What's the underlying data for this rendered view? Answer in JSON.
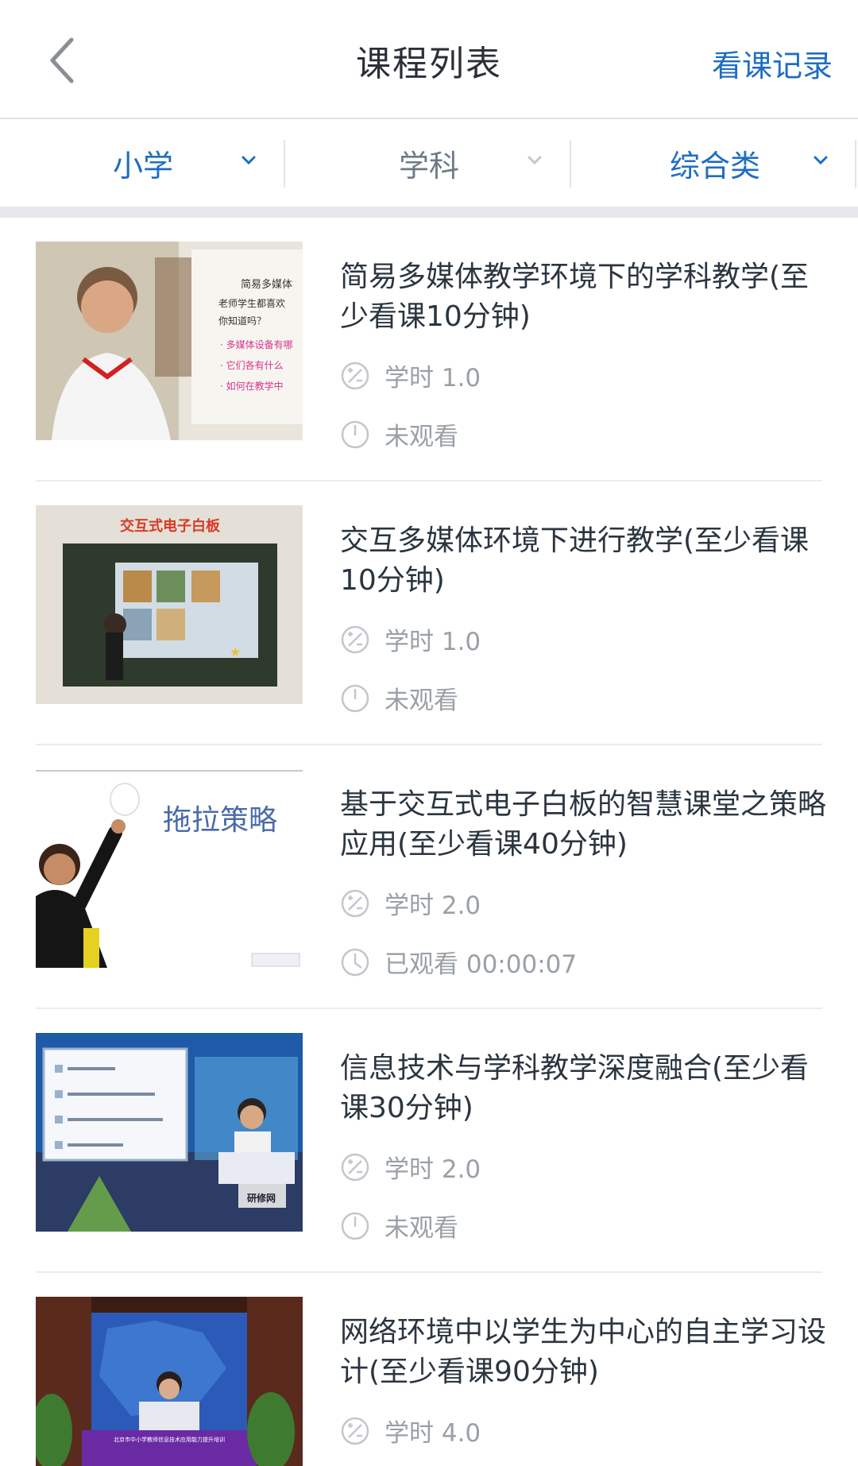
{
  "header": {
    "title": "课程列表",
    "history_label": "看课记录"
  },
  "filters": [
    {
      "label": "小学",
      "active": true
    },
    {
      "label": "学科",
      "active": false
    },
    {
      "label": "综合类",
      "active": true
    }
  ],
  "colors": {
    "accent": "#1f6ec0",
    "meta_gray": "#9aa0a6",
    "title_text": "#2b3540"
  },
  "courses": [
    {
      "title": "简易多媒体教学环境下的学科教学(至少看课10分钟)",
      "hours_label": "学时 1.0",
      "status": "未观看",
      "status_icon": "progress-empty-icon",
      "thumb_text": {
        "slide_title": "简易多媒体",
        "line1": "老师学生都喜欢",
        "line2": "你知道吗？",
        "bullet1": "· 多媒体设备有哪",
        "bullet2": "· 它们各有什么",
        "bullet3": "· 如何在教学中"
      }
    },
    {
      "title": "交互多媒体环境下进行教学(至少看课10分钟)",
      "hours_label": "学时 1.0",
      "status": "未观看",
      "status_icon": "progress-empty-icon",
      "thumb_text": {
        "slide_title": "交互式电子白板"
      }
    },
    {
      "title": "基于交互式电子白板的智慧课堂之策略应用(至少看课40分钟)",
      "hours_label": "学时 2.0",
      "status": "已观看 00:00:07",
      "status_icon": "clock-icon",
      "thumb_text": {
        "slide_title": "拖拉策略"
      }
    },
    {
      "title": "信息技术与学科教学深度融合(至少看课30分钟)",
      "hours_label": "学时 2.0",
      "status": "未观看",
      "status_icon": "progress-empty-icon",
      "thumb_text": {
        "logo": "研修网"
      }
    },
    {
      "title": "网络环境中以学生为中心的自主学习设计(至少看课90分钟)",
      "hours_label": "学时 4.0",
      "status": "",
      "status_icon": "",
      "thumb_text": {
        "banner": "北京市中小学教师信息技术应用能力提升培训"
      }
    }
  ]
}
